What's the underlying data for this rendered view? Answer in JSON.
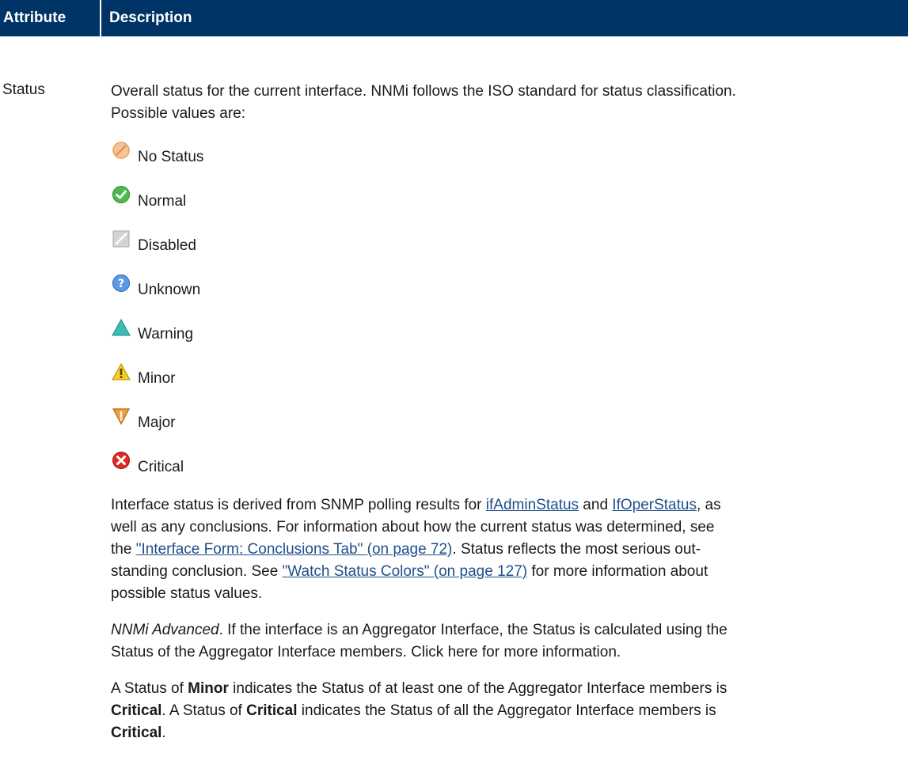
{
  "header": {
    "col_attribute": "Attribute",
    "col_description": "Description"
  },
  "row": {
    "attribute": "Status",
    "intro_line1": "Overall status for the current interface. NNMi follows the ISO standard for status classification.",
    "intro_line2": "Possible values are:",
    "statuses": [
      {
        "label": "No Status",
        "icon": "no-status-icon",
        "color": "#f0a868"
      },
      {
        "label": "Normal",
        "icon": "normal-check-icon",
        "color": "#3faa3f"
      },
      {
        "label": "Disabled",
        "icon": "disabled-square-icon",
        "color": "#b8b8b8"
      },
      {
        "label": "Unknown",
        "icon": "unknown-question-icon",
        "color": "#3a7fd5"
      },
      {
        "label": "Warning",
        "icon": "warning-triangle-icon",
        "color": "#2fb0a8"
      },
      {
        "label": "Minor",
        "icon": "minor-warning-icon",
        "color": "#f2c200"
      },
      {
        "label": "Major",
        "icon": "major-inverted-triangle-icon",
        "color": "#e08020"
      },
      {
        "label": "Critical",
        "icon": "critical-x-icon",
        "color": "#d62020"
      }
    ],
    "p1": {
      "t1": "Interface status is derived from SNMP polling results for ",
      "link1": " ifAdminStatus",
      "t2": " and ",
      "link2": "IfOperStatus",
      "t3": ", as",
      "line2": "well as any conclusions. For information about how the current status was determined, see",
      "t4": "the ",
      "link3": "\"Interface Form: Conclusions Tab\" (on page 72)",
      "t5": ". Status reflects the most serious out-",
      "t6": "standing conclusion. See ",
      "link4": "\"Watch Status Colors\" (on page 127)",
      "t7": " for more information about",
      "line5": "possible status values."
    },
    "p2": {
      "italic": "NNMi Advanced",
      "line1_rest": ". If the interface is an Aggregator Interface, the Status is calculated using the",
      "line2": "Status of the Aggregator Interface members. Click here for more information."
    },
    "p3": {
      "t1": "A Status of ",
      "b1": "Minor",
      "t2": " indicates the Status of at least one of the Aggregator Interface members is",
      "b2": "Critical",
      "t3": ". A Status of ",
      "b3": "Critical",
      "t4": " indicates the Status of all the Aggregator Interface members is",
      "b4": "Critical",
      "t5": "."
    },
    "colors": {
      "header_bg": "#003366",
      "link": "#1f4f8a"
    }
  }
}
